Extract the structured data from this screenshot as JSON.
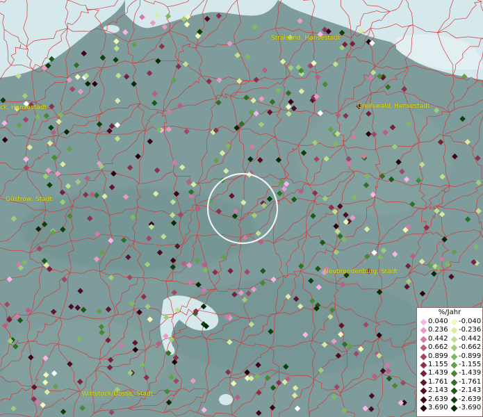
{
  "map": {
    "cities": [
      {
        "id": "stralsund",
        "label": "Stralsund, Hansestadt"
      },
      {
        "id": "rostock",
        "label": "ck, Hansestadt"
      },
      {
        "id": "greifswald",
        "label": "Greifswald, Hansestadt"
      },
      {
        "id": "guestrow",
        "label": "Güstrow, Stadt"
      },
      {
        "id": "neubrandenburg",
        "label": "Neubrandenburg, Stadt"
      },
      {
        "id": "wittstock",
        "label": "Wittstock/Dosse, Stadt"
      }
    ],
    "colors": {
      "water": "#d5e8ec",
      "land": "#7d9c9b",
      "boundary": "#d43a3a",
      "city_label": "#e4df1a"
    }
  },
  "legend": {
    "title": "%/Jahr",
    "positive": [
      {
        "label": "0.040",
        "color": "#f7b6e8"
      },
      {
        "label": "0.236",
        "color": "#e79bcb"
      },
      {
        "label": "0.442",
        "color": "#cf7ba6"
      },
      {
        "label": "0.662",
        "color": "#b85d84"
      },
      {
        "label": "0.899",
        "color": "#a04666"
      },
      {
        "label": "1.155",
        "color": "#8a3150"
      },
      {
        "label": "1.439",
        "color": "#76203e"
      },
      {
        "label": "1.761",
        "color": "#62142e"
      },
      {
        "label": "2.143",
        "color": "#500a22"
      },
      {
        "label": "2.639",
        "color": "#3c0418"
      },
      {
        "label": "3.690",
        "color": "#28000d"
      }
    ],
    "negative": [
      {
        "label": "-0.040",
        "color": "#f3f8b9"
      },
      {
        "label": "-0.236",
        "color": "#d9eca6"
      },
      {
        "label": "-0.442",
        "color": "#bfe090"
      },
      {
        "label": "-0.662",
        "color": "#a0cd7b"
      },
      {
        "label": "-0.899",
        "color": "#80b864"
      },
      {
        "label": "-1.155",
        "color": "#62a04d"
      },
      {
        "label": "-1.439",
        "color": "#468838"
      },
      {
        "label": "-1.761",
        "color": "#2f7026"
      },
      {
        "label": "-2.143",
        "color": "#1c5818"
      },
      {
        "label": "-2.639",
        "color": "#0e400d"
      },
      {
        "label": "-3.690",
        "color": "#052a06"
      }
    ]
  }
}
